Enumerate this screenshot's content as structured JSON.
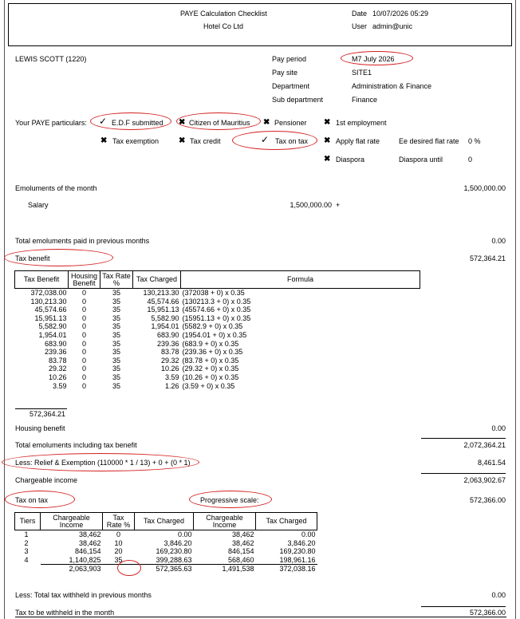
{
  "header": {
    "title": "PAYE Calculation Checklist",
    "company": "Hotel Co Ltd",
    "date_label": "Date",
    "date_value": "10/07/2026 05:29",
    "user_label": "User",
    "user_value": "admin@unic"
  },
  "employee": {
    "name": "LEWIS SCOTT (1220)",
    "fields": [
      {
        "label": "Pay period",
        "value": "M7 July 2026"
      },
      {
        "label": "Pay site",
        "value": "SITE1"
      },
      {
        "label": "Department",
        "value": "Administration & Finance"
      },
      {
        "label": "Sub department",
        "value": "Finance"
      }
    ]
  },
  "particulars": {
    "label": "Your PAYE particulars:",
    "items": {
      "edf": {
        "mark": "✓",
        "label": "E.D.F submitted"
      },
      "citizen": {
        "mark": "✖",
        "label": "Citizen of Mauritius"
      },
      "pensioner": {
        "mark": "✖",
        "label": "Pensioner"
      },
      "first_emp": {
        "mark": "✖",
        "label": "1st employment"
      },
      "tax_exemption": {
        "mark": "✖",
        "label": "Tax exemption"
      },
      "tax_credit": {
        "mark": "✖",
        "label": "Tax credit"
      },
      "tax_on_tax": {
        "mark": "✓",
        "label": "Tax on tax"
      },
      "flat_rate": {
        "mark": "✖",
        "label": "Apply flat rate"
      },
      "diaspora": {
        "mark": "✖",
        "label": "Diaspora"
      }
    },
    "ee_flat_rate_label": "Ee desired flat rate",
    "ee_flat_rate_value": "0 %",
    "diaspora_until_label": "Diaspora until",
    "diaspora_until_value": "0"
  },
  "emoluments": {
    "label": "Emoluments of the month",
    "total": "1,500,000.00",
    "salary_label": "Salary",
    "salary_value": "1,500,000.00",
    "salary_sign": "+",
    "prev_label": "Total emoluments paid in previous months",
    "prev_value": "0.00"
  },
  "tax_benefit": {
    "label": "Tax benefit",
    "value": "572,364.21",
    "headers": [
      "Tax Benefit",
      "Housing Benefit",
      "Tax Rate %",
      "Tax Charged",
      "Formula"
    ],
    "rows": [
      [
        "372,038.00",
        "0",
        "35",
        "130,213.30",
        "(372038 + 0) x 0.35"
      ],
      [
        "130,213.30",
        "0",
        "35",
        "45,574.66",
        "(130213.3 + 0) x 0.35"
      ],
      [
        "45,574.66",
        "0",
        "35",
        "15,951.13",
        "(45574.66 + 0) x 0.35"
      ],
      [
        "15,951.13",
        "0",
        "35",
        "5,582.90",
        "(15951.13 + 0) x 0.35"
      ],
      [
        "5,582.90",
        "0",
        "35",
        "1,954.01",
        "(5582.9 + 0) x 0.35"
      ],
      [
        "1,954.01",
        "0",
        "35",
        "683.90",
        "(1954.01 + 0) x 0.35"
      ],
      [
        "683.90",
        "0",
        "35",
        "239.36",
        "(683.9 + 0) x 0.35"
      ],
      [
        "239.36",
        "0",
        "35",
        "83.78",
        "(239.36 + 0) x 0.35"
      ],
      [
        "83.78",
        "0",
        "35",
        "29.32",
        "(83.78 + 0) x 0.35"
      ],
      [
        "29.32",
        "0",
        "35",
        "10.26",
        "(29.32 + 0) x 0.35"
      ],
      [
        "10.26",
        "0",
        "35",
        "3.59",
        "(10.26 + 0) x 0.35"
      ],
      [
        "3.59",
        "0",
        "35",
        "1.26",
        "(3.59 + 0) x 0.35"
      ]
    ],
    "total": "572,364.21"
  },
  "summary": {
    "housing_label": "Housing benefit",
    "housing_value": "0.00",
    "total_incl_label": "Total emoluments including tax benefit",
    "total_incl_value": "2,072,364.21",
    "relief_label": "Less: Relief & Exemption (110000 * 1 / 13) + 0 + (0 * 1)",
    "relief_value": "8,461.54",
    "chargeable_label": "Chargeable income",
    "chargeable_value": "2,063,902.67"
  },
  "tax_on_tax": {
    "label": "Tax on tax",
    "progressive_label": "Progressive scale:",
    "value": "572,366.00",
    "headers": [
      "Tiers",
      "Chargeable Income",
      "Tax Rate %",
      "Tax Charged",
      "Chargeable Income",
      "Tax Charged"
    ],
    "rows": [
      [
        "1",
        "38,462",
        "0",
        "0.00",
        "38,462",
        "0.00"
      ],
      [
        "2",
        "38,462",
        "10",
        "3,846.20",
        "38,462",
        "3,846.20"
      ],
      [
        "3",
        "846,154",
        "20",
        "169,230.80",
        "846,154",
        "169,230.80"
      ],
      [
        "4",
        "1,140,825",
        "35",
        "399,288.63",
        "568,460",
        "198,961.16"
      ]
    ],
    "totals": [
      "",
      "2,063,903",
      "",
      "572,365.63",
      "1,491,538",
      "372,038.16"
    ]
  },
  "footer": {
    "withheld_prev_label": "Less: Total tax withheld in previous months",
    "withheld_prev_value": "0.00",
    "to_withhold_label": "Tax to be withheld in the month",
    "to_withhold_value": "572,366.00"
  }
}
